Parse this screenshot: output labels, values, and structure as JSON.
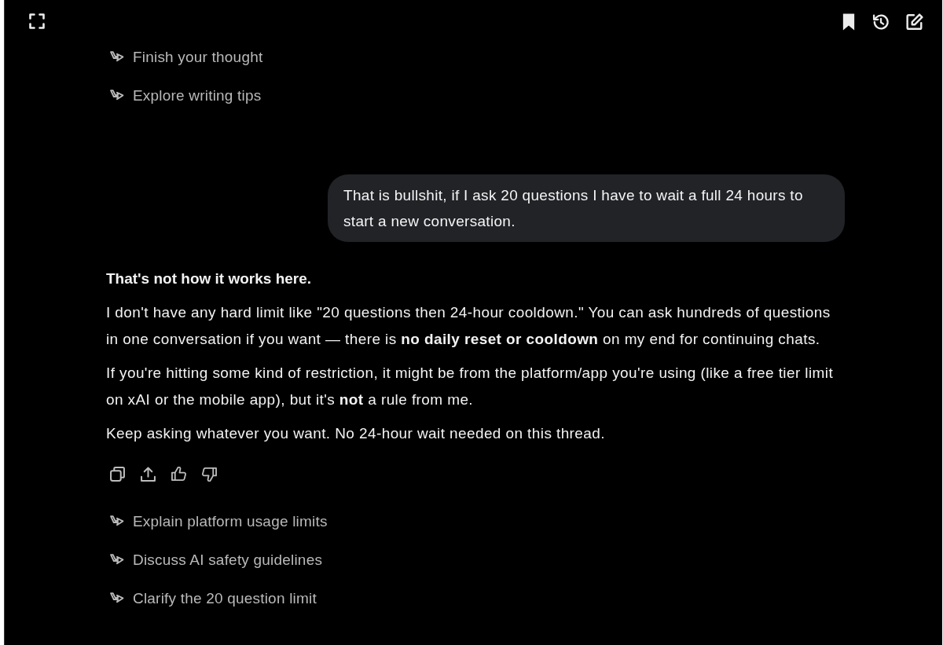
{
  "suggestions_top": [
    "Finish your thought",
    "Explore writing tips"
  ],
  "user_message": {
    "text": "That is bullshit, if I ask 20 questions I have to wait a full 24 hours to start a new conversation."
  },
  "assistant_message": {
    "heading": "That's not how it works here.",
    "paragraphs": [
      "I don't have any hard limit like \"20 questions then 24-hour cooldown.\" You can ask hundreds of questions in one conversation if you want — there is **no daily reset or cooldown** on my end for continuing chats.",
      "If you're hitting some kind of restriction, it might be from the platform/app you're using (like a free tier limit on xAI or the mobile app), but it's **not** a rule from me.",
      "Keep asking whatever you want. No 24-hour wait needed on this thread."
    ]
  },
  "suggestions": [
    "Explain platform usage limits",
    "Discuss AI safety guidelines",
    "Clarify the 20 question limit"
  ]
}
